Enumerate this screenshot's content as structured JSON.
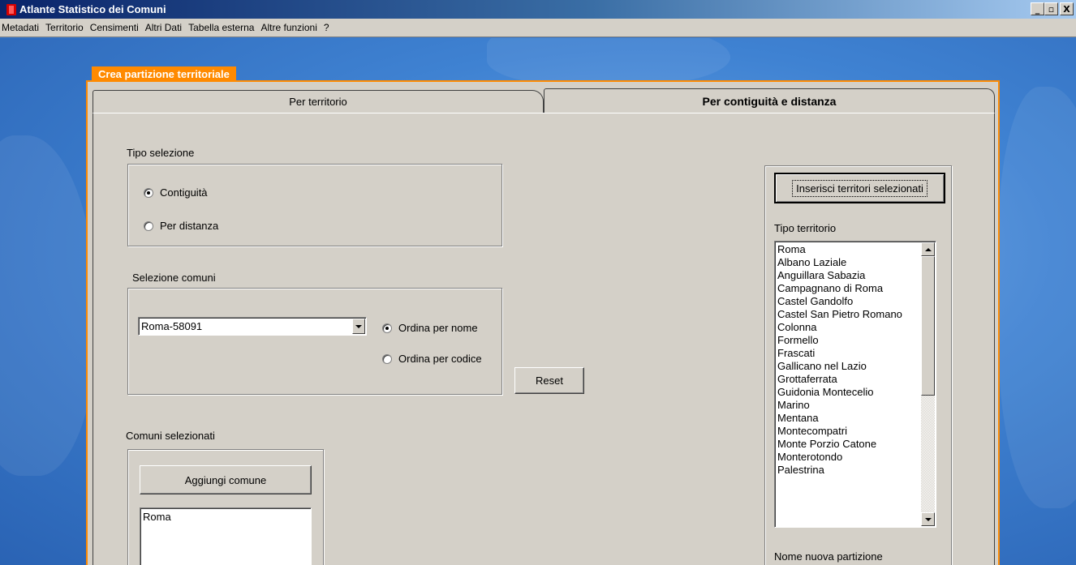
{
  "window": {
    "title": "Atlante Statistico dei Comuni",
    "controls": {
      "minimize": "_",
      "maximize": "▫",
      "close": "X"
    }
  },
  "menu": {
    "items": [
      "Metadati",
      "Territorio",
      "Censimenti",
      "Altri Dati",
      "Tabella esterna",
      "Altre funzioni",
      "?"
    ]
  },
  "dialog": {
    "caption": "Crea partizione territoriale",
    "tabs": [
      {
        "label": "Per territorio",
        "active": false
      },
      {
        "label": "Per contiguità e distanza",
        "active": true
      }
    ]
  },
  "tipo_selezione": {
    "label": "Tipo selezione",
    "options": [
      {
        "label": "Contiguità",
        "checked": true
      },
      {
        "label": "Per distanza",
        "checked": false
      }
    ]
  },
  "selezione_comuni": {
    "label": "Selezione comuni",
    "combo_value": "Roma-58091",
    "order_options": [
      {
        "label": "Ordina per nome",
        "checked": true
      },
      {
        "label": "Ordina per codice",
        "checked": false
      }
    ],
    "reset_label": "Reset"
  },
  "comuni_selezionati": {
    "label": "Comuni selezionati",
    "add_button": "Aggiungi comune",
    "items": [
      "Roma"
    ]
  },
  "right_panel": {
    "insert_button": "Inserisci territori selezionati",
    "tipo_territorio_label": "Tipo territorio",
    "territori": [
      "Roma",
      "Albano Laziale",
      "Anguillara Sabazia",
      "Campagnano di Roma",
      "Castel Gandolfo",
      "Castel San Pietro Romano",
      "Colonna",
      "Formello",
      "Frascati",
      "Gallicano nel Lazio",
      "Grottaferrata",
      "Guidonia Montecelio",
      "Marino",
      "Mentana",
      "Montecompatri",
      "Monte Porzio Catone",
      "Monterotondo",
      "Palestrina"
    ],
    "nome_partizione_label": "Nome nuova partizione"
  },
  "colors": {
    "accent_orange": "#ff8a00",
    "titlebar_start": "#0a246a",
    "face": "#d4d0c8"
  }
}
